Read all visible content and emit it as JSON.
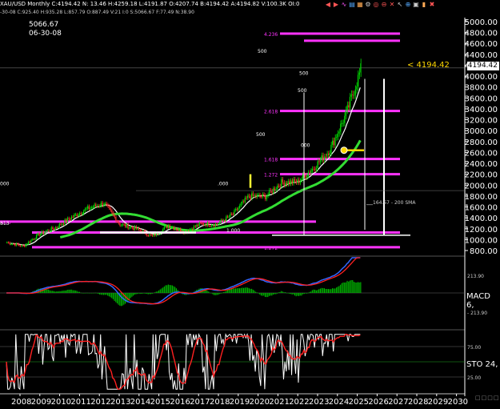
{
  "header": {
    "ticker": "XAU/USD Monthly  C:4194.42  N: 13.46  H:4259.18  L:4191.87  O:4207.74  B:4194.42  A:4194.82  V:100.3K  OI:0",
    "ohlc_line": "-30-08  C:925.40  H:935.28  L:857.79  O:887.49  V:21  I:0  S:5066.67  F:77.49  N:38.90",
    "ref_value": "5066.67",
    "ref_date": "06-30-08",
    "current_price": "4194.42",
    "price_note": "< 4194.42"
  },
  "toolbar": {
    "icons": [
      "arrow-left-icon",
      "arrow-right-icon",
      "wave-icon",
      "chart-icon",
      "grid-icon",
      "gear-icon",
      "target-icon",
      "stop-icon",
      "cross-icon",
      "cursor-icon",
      "zoom-icon",
      "print-icon",
      "lock-icon",
      "close-icon"
    ]
  },
  "colors": {
    "candle_up": "#00e000",
    "candle_down": "#ff3030",
    "ma_short": "#ffffff",
    "ma_long": "#33dd33",
    "fib": "#ff33ff",
    "macd_line": "#3366ff",
    "signal_line": "#ff2020",
    "stoch_k": "#ffffff",
    "stoch_d": "#ff2020",
    "hist": "#00c000"
  },
  "indicators": {
    "macd_label": "MACD 6,",
    "sto_label": "STO  24,",
    "sma_label": "164.57 - 200 SMA"
  },
  "corner_text": "□□□□",
  "chart_data": [
    {
      "type": "line",
      "title": "",
      "series": [
        {
          "name": "",
          "values": [
            950,
            880,
            1100,
            1220,
            1410,
            1570,
            1670,
            1280,
            1200,
            1060,
            1260,
            1140,
            1290,
            1280,
            1470,
            1800,
            1790,
            2050,
            2060,
            2320,
            2650,
            3300,
            4194.42
          ]
        }
      ],
      "x": [
        2008,
        2009,
        2010,
        2011,
        2012,
        2013,
        2014,
        2015,
        2016,
        2017,
        2018,
        2019,
        2020,
        2021,
        2022,
        2023,
        2024,
        2025
      ],
      "xticks": [
        "2008",
        "2009",
        "2010",
        "2011",
        "2012",
        "2013",
        "2014",
        "2015",
        "2016",
        "2017",
        "2018",
        "2019",
        "2020",
        "2021",
        "2022",
        "2023",
        "2024",
        "2025",
        "2026",
        "2027",
        "2028",
        "2029",
        "2030"
      ],
      "yticks": [
        "5000.00",
        "4800.00",
        "4600.00",
        "4400.00",
        "4200.00",
        "4000.00",
        "3800.00",
        "3600.00",
        "3400.00",
        "3200.00",
        "3000.00",
        "2800.00",
        "2600.00",
        "2400.00",
        "2200.00",
        "2000.00",
        "1800.00",
        "1600.00",
        "1400.00",
        "1200.00",
        "1000.00",
        "800.00"
      ],
      "ylim": [
        800,
        5000
      ],
      "fib_levels": [
        {
          "label": "4.236",
          "value": 4780
        },
        {
          "label": "2.618",
          "value": 3360
        },
        {
          "label": "1.618",
          "value": 2480
        },
        {
          "label": "1.272",
          "value": 2200
        },
        {
          "label": "236",
          "value": 1330
        },
        {
          "label": "1.272",
          "value": 860
        }
      ],
      "annotations": [
        "500",
        "500",
        "500",
        "500",
        "500",
        "000",
        "000",
        ".000",
        "1.000"
      ]
    },
    {
      "type": "bar",
      "name": "MACD",
      "ylabels": [
        "213.90",
        "- 213.90"
      ]
    },
    {
      "type": "line",
      "name": "Stochastic",
      "ylabels": [
        "75.00",
        "25.00"
      ]
    }
  ]
}
